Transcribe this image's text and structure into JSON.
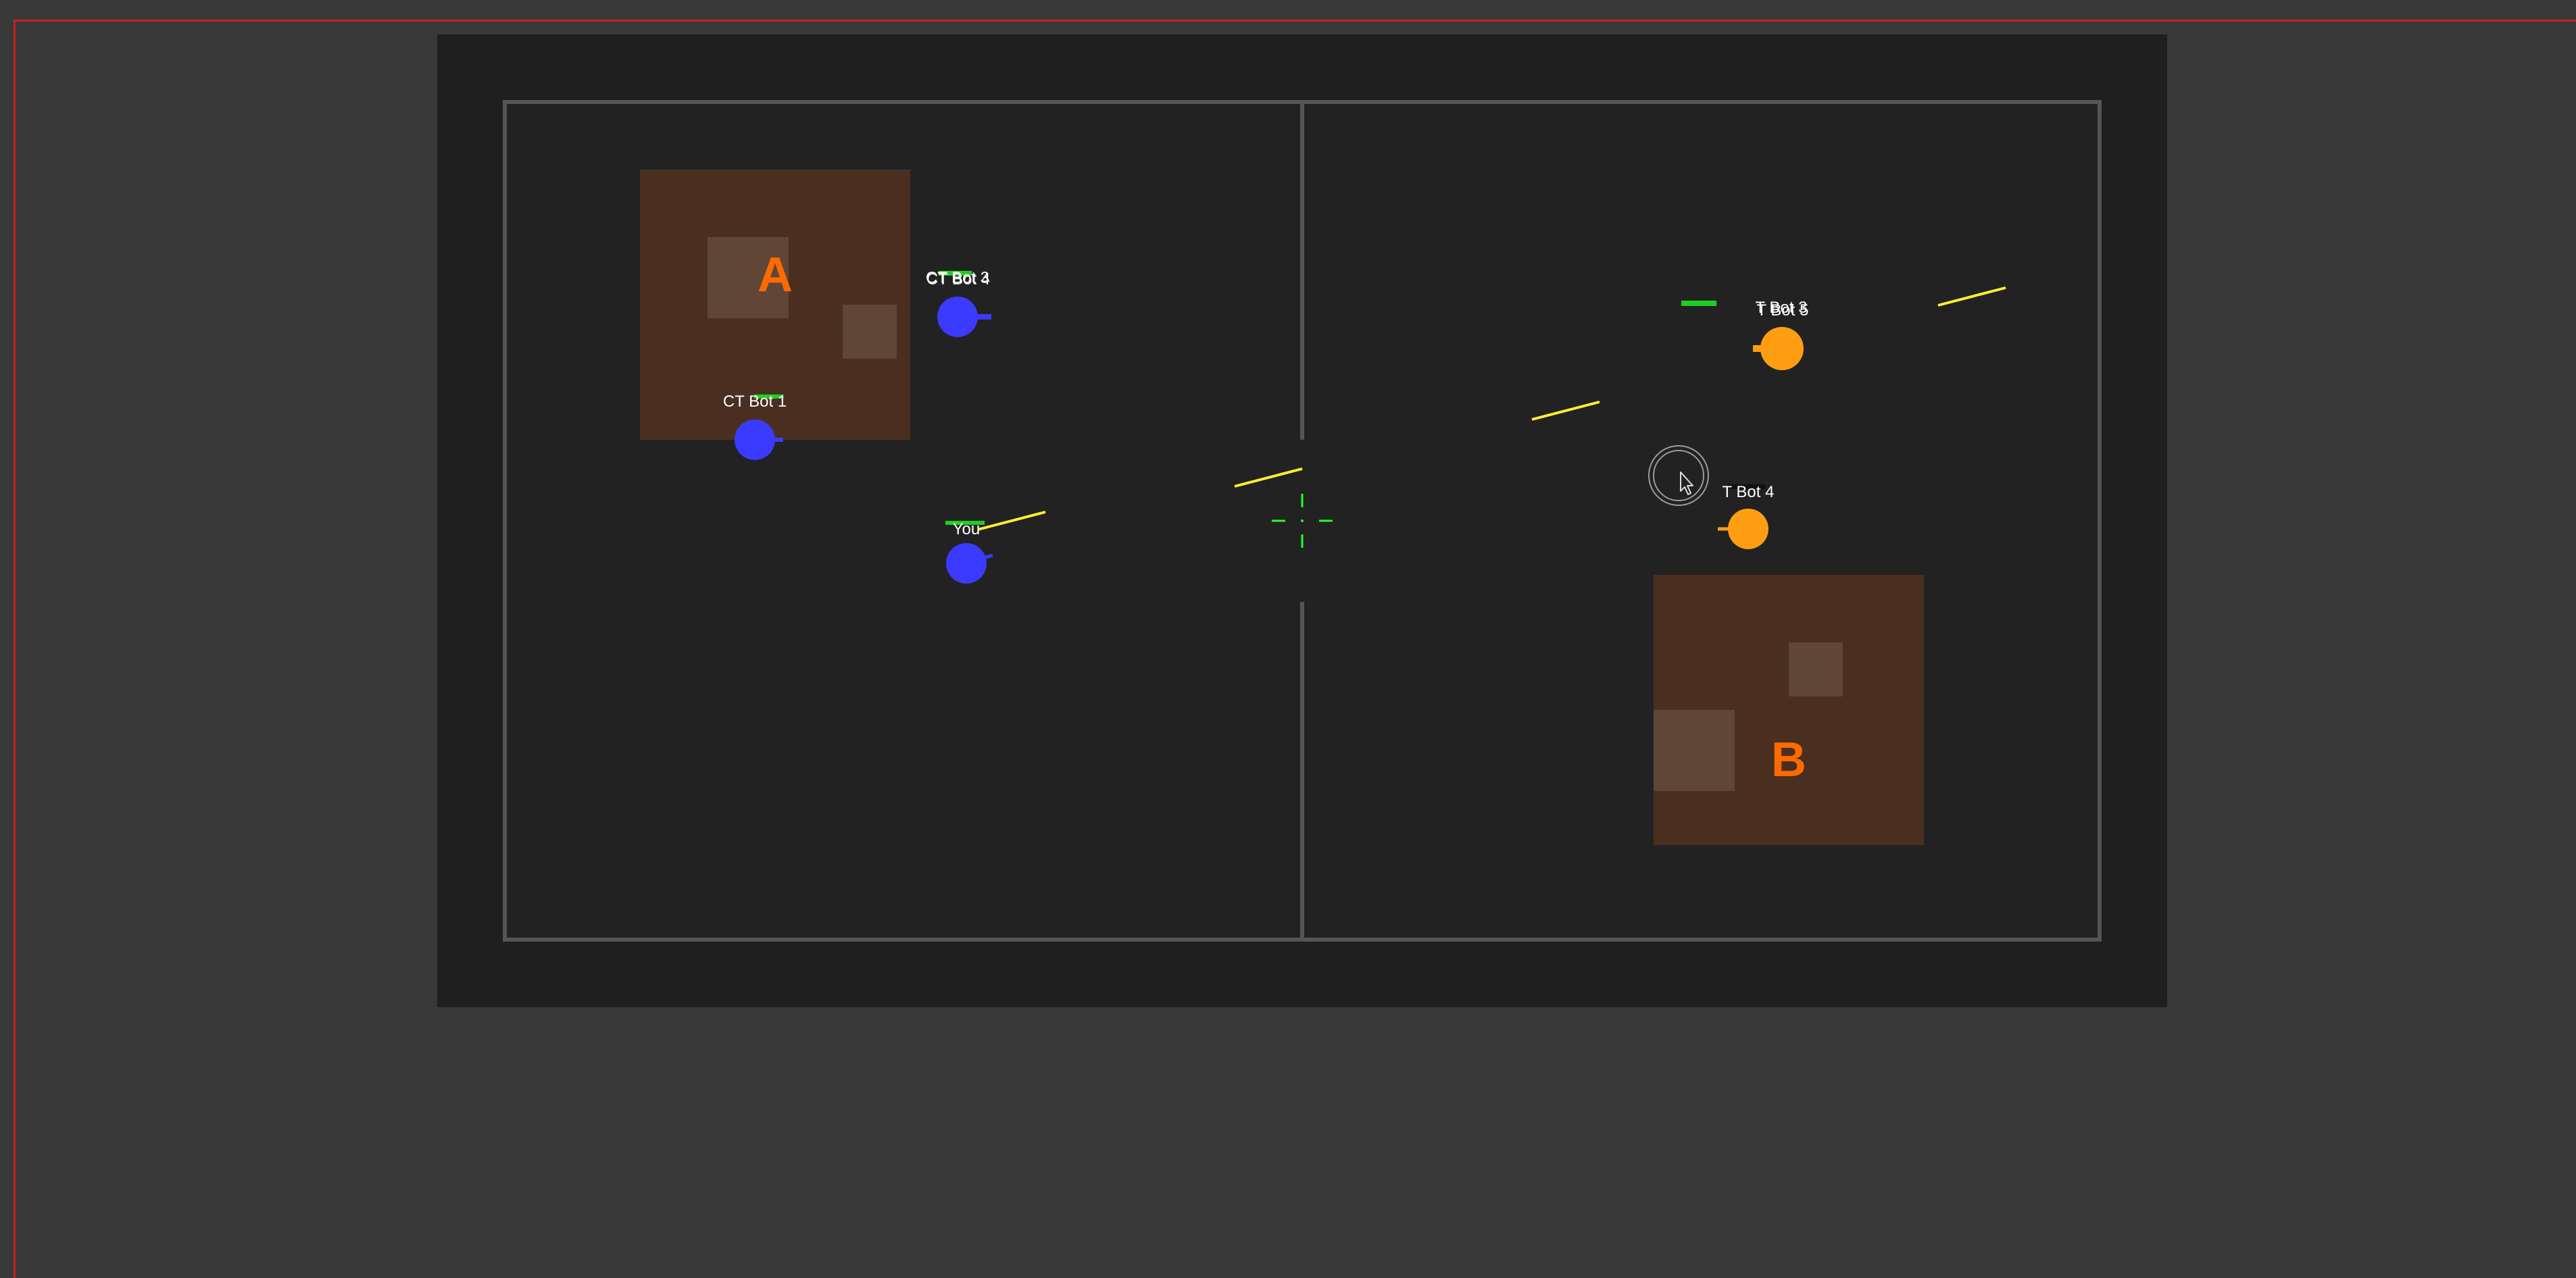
{
  "game": {
    "sites": [
      {
        "id": "a",
        "label": "A"
      },
      {
        "id": "b",
        "label": "B"
      }
    ],
    "players": [
      {
        "id": "ct-bot-1",
        "name": "CT Bot 1",
        "team": "CT",
        "health": 0.75
      },
      {
        "id": "ct-bot-overlap",
        "name": "CT Bot 4",
        "overlapped_name": "CT Bot 3",
        "team": "CT",
        "health": 0.85
      },
      {
        "id": "you",
        "name": "You",
        "team": "CT",
        "health": 1.0
      },
      {
        "id": "t-bot-5",
        "name": "T Bot 5",
        "overlapped_name": "T Bot 3",
        "team": "T",
        "health": 0.9
      },
      {
        "id": "t-bot-4",
        "name": "T Bot 4",
        "team": "T",
        "health": 0.0
      }
    ]
  },
  "colors": {
    "page_background": "#393939",
    "map_frame": "#1f1f1f",
    "map_floor": "#222222",
    "walls": "#555555",
    "site_zone": "#4a2f20",
    "crate": "#5f4636",
    "site_label": "#ff6a00",
    "ct_team": "#3b3bff",
    "t_team": "#ff9e12",
    "health_bar": "#22cc22",
    "tracer": "#ffee33",
    "crosshair": "#22ff22",
    "window_border": "#cc1f1f"
  },
  "icons": {
    "crosshair": "crosshair-icon",
    "cursor": "mouse-pointer-icon"
  }
}
